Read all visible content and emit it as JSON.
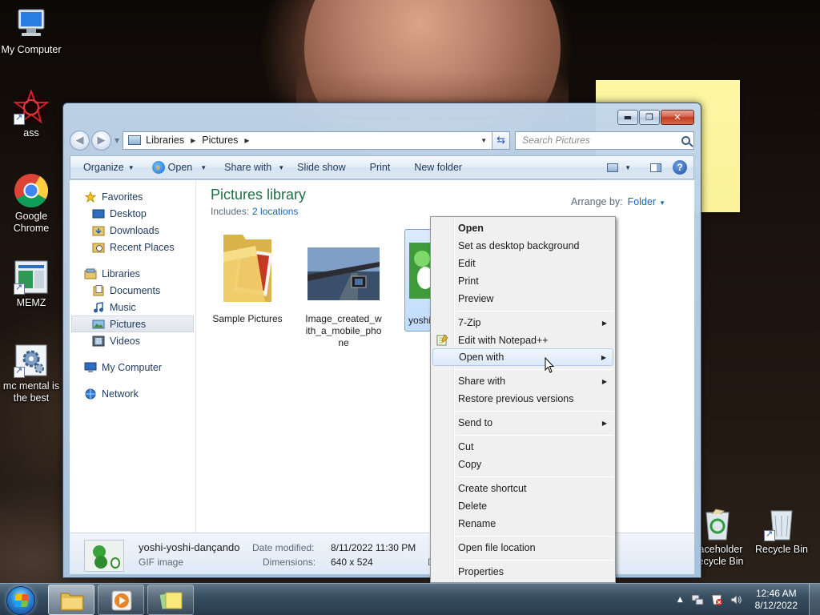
{
  "desktop": {
    "icons": [
      {
        "label": "My Computer"
      },
      {
        "label": "ass"
      },
      {
        "label": "Google Chrome"
      },
      {
        "label": "MEMZ"
      },
      {
        "label": "mc mental is the best"
      },
      {
        "label": "aceholder ecycle Bin"
      },
      {
        "label": "Recycle Bin"
      }
    ]
  },
  "window": {
    "address": {
      "crumbs": [
        "Libraries",
        "Pictures"
      ]
    },
    "search": {
      "placeholder": "Search Pictures"
    },
    "commands": {
      "organize": "Organize",
      "open": "Open",
      "share_with": "Share with",
      "slide_show": "Slide show",
      "print": "Print",
      "new_folder": "New folder"
    },
    "nav": {
      "favorites": "Favorites",
      "desktop": "Desktop",
      "downloads": "Downloads",
      "recent_places": "Recent Places",
      "libraries": "Libraries",
      "documents": "Documents",
      "music": "Music",
      "pictures": "Pictures",
      "videos": "Videos",
      "my_computer": "My Computer",
      "network": "Network"
    },
    "library": {
      "title": "Pictures library",
      "includes_label": "Includes:",
      "includes_link": "2 locations",
      "arrange_label": "Arrange by:",
      "arrange_value": "Folder"
    },
    "files": [
      {
        "name": "Sample Pictures"
      },
      {
        "name": "Image_created_with_a_mobile_phone"
      },
      {
        "name": "yoshi"
      }
    ],
    "details": {
      "name": "yoshi-yoshi-dançando",
      "type": "GIF image",
      "date_label": "Date modified:",
      "date_value": "8/11/2022 11:30 PM",
      "dim_label": "Dimensions:",
      "dim_value": "640 x 524",
      "extra_label": "Da"
    }
  },
  "context_menu": {
    "items": {
      "open": "Open",
      "set_bg": "Set as desktop background",
      "edit": "Edit",
      "print": "Print",
      "preview": "Preview",
      "zip": "7-Zip",
      "notepad": "Edit with Notepad++",
      "open_with": "Open with",
      "share_with": "Share with",
      "restore": "Restore previous versions",
      "send_to": "Send to",
      "cut": "Cut",
      "copy": "Copy",
      "create_shortcut": "Create shortcut",
      "delete": "Delete",
      "rename": "Rename",
      "open_location": "Open file location",
      "properties": "Properties"
    }
  },
  "taskbar": {
    "clock_time": "12:46 AM",
    "clock_date": "8/12/2022"
  },
  "colors": {
    "library_title": "#1f6e43",
    "link": "#1a66b3",
    "sticky": "#fbf29a"
  }
}
